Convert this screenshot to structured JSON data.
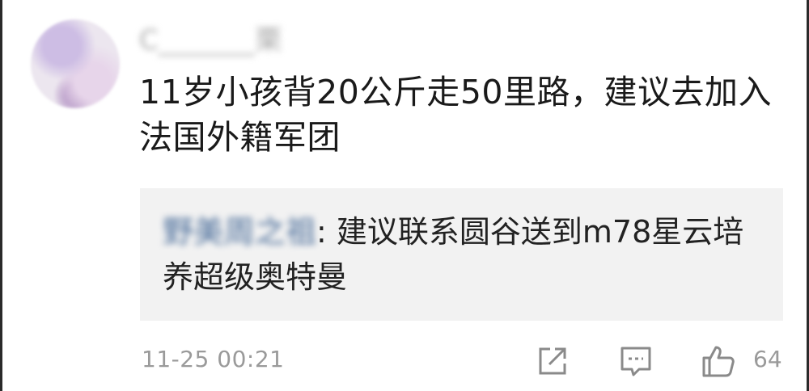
{
  "comment": {
    "username": "C_______栗",
    "text": "11岁小孩背20公斤走50里路，建议去加入法国外籍军团",
    "timestamp": "11-25 00:21",
    "like_count": "64"
  },
  "reply": {
    "user": "野美周之祖",
    "separator": ": ",
    "text": "建议联系圆谷送到m78星云培养超级奥特曼"
  },
  "icons": {
    "share": "share-icon",
    "reply": "reply-icon",
    "like": "thumbs-up-icon"
  },
  "colors": {
    "reply_user": "#4a6d9a",
    "reply_bg": "#f2f2f2",
    "meta_text": "#9a9a9a"
  }
}
